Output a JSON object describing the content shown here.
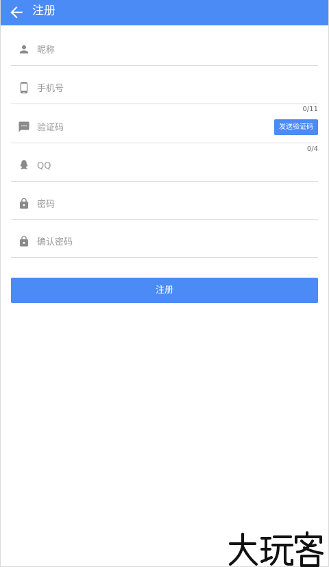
{
  "appbar": {
    "title": "注册",
    "back_icon": "arrow-left-icon"
  },
  "form": {
    "nickname": {
      "placeholder": "昵称",
      "value": "",
      "icon": "person-icon"
    },
    "phone": {
      "placeholder": "手机号",
      "value": "",
      "icon": "phone-icon",
      "counter": "0/11"
    },
    "code": {
      "placeholder": "验证码",
      "value": "",
      "icon": "message-icon",
      "send_label": "发送验证码",
      "counter": "0/4"
    },
    "qq": {
      "placeholder": "QQ",
      "value": "",
      "icon": "qq-icon"
    },
    "password": {
      "placeholder": "密码",
      "value": "",
      "icon": "lock-icon"
    },
    "confirm_password": {
      "placeholder": "确认密码",
      "value": "",
      "icon": "lock-icon"
    }
  },
  "register_button": {
    "label": "注册"
  },
  "watermark": {
    "text": "大玩客"
  },
  "colors": {
    "accent": "#4b8bf5",
    "icon": "#8a8a8a",
    "divider": "#dcdcdc"
  }
}
